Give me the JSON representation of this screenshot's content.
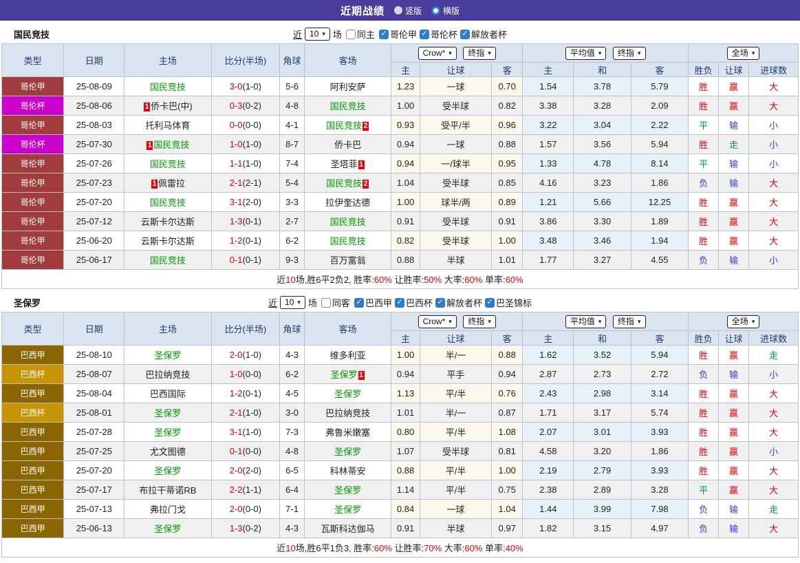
{
  "topbar": {
    "title": "近期战绩",
    "vertical_label": "竖版",
    "horizontal_label": "横版",
    "selected": "horizontal"
  },
  "colors": {
    "topbar_bg": "#4A3C9C",
    "colombia_league": "#A23B3B",
    "colombia_cup": "#CC00CC",
    "brazil_league": "#8A6500",
    "brazil_cup": "#C79405",
    "focus_team_green": "#009900",
    "win_red": "#E60000",
    "draw_green": "#009933",
    "lose_blue": "#3340DF",
    "header_bg": "#DAE5F1",
    "odds_bg": "#FCF8EC",
    "avg_bg": "#E6F1F8"
  },
  "headers": {
    "type": "类型",
    "date": "日期",
    "home": "主场",
    "score": "比分(半场)",
    "corner": "角球",
    "away": "客场",
    "oh": "主",
    "ohc": "让球",
    "oa": "客",
    "ah": "主",
    "ad": "和",
    "aa": "客",
    "res": "胜负",
    "hres": "让球",
    "goals": "进球数",
    "selects": {
      "crow": "Crow*",
      "final": "终指",
      "avg": "平均值",
      "final2": "终指",
      "full": "全场"
    }
  },
  "sections": [
    {
      "team": "国民竞技",
      "filter": {
        "near": "近",
        "count": "10",
        "field": "场",
        "same": {
          "label": "同主",
          "checked": false
        },
        "leagues": [
          {
            "label": "哥伦甲",
            "checked": true
          },
          {
            "label": "哥伦杯",
            "checked": true
          },
          {
            "label": "解放者杯",
            "checked": true
          }
        ]
      },
      "rows": [
        {
          "type": "哥伦甲",
          "type_color": "#A23B3B",
          "date": "25-08-09",
          "home": {
            "name": "国民竞技",
            "focus": true
          },
          "score": "3-0",
          "half": "(1-0)",
          "corners": "5-6",
          "away": {
            "name": "阿利安萨",
            "focus": false
          },
          "odds": [
            "1.23",
            "一球",
            "0.70"
          ],
          "avg": [
            "1.54",
            "3.78",
            "5.79"
          ],
          "results": [
            [
              "胜",
              "r"
            ],
            [
              "赢",
              "r"
            ],
            [
              "大",
              "r"
            ]
          ]
        },
        {
          "type": "哥伦杯",
          "type_color": "#CC00CC",
          "date": "25-08-06",
          "home": {
            "name": "侨卡巴(中)",
            "focus": false,
            "badge_before": "1"
          },
          "score": "0-3",
          "half": "(0-2)",
          "corners": "4-8",
          "away": {
            "name": "国民竞技",
            "focus": true
          },
          "odds": [
            "1.00",
            "受半球",
            "0.82"
          ],
          "avg": [
            "3.38",
            "3.28",
            "2.09"
          ],
          "results": [
            [
              "胜",
              "r"
            ],
            [
              "赢",
              "r"
            ],
            [
              "大",
              "r"
            ]
          ]
        },
        {
          "type": "哥伦甲",
          "type_color": "#A23B3B",
          "date": "25-08-03",
          "home": {
            "name": "托利马体育",
            "focus": false
          },
          "score": "0-0",
          "half": "(0-0)",
          "corners": "4-1",
          "away": {
            "name": "国民竞技",
            "focus": true,
            "badge_after": "2"
          },
          "odds": [
            "0.93",
            "受平/半",
            "0.96"
          ],
          "avg": [
            "3.22",
            "3.04",
            "2.22"
          ],
          "results": [
            [
              "平",
              "g"
            ],
            [
              "输",
              "b"
            ],
            [
              "小",
              "b"
            ]
          ]
        },
        {
          "type": "哥伦杯",
          "type_color": "#CC00CC",
          "date": "25-07-30",
          "home": {
            "name": "国民竞技",
            "focus": true,
            "badge_before": "1"
          },
          "score": "1-0",
          "half": "(1-0)",
          "corners": "8-7",
          "away": {
            "name": "侨卡巴",
            "focus": false
          },
          "odds": [
            "0.94",
            "一球",
            "0.88"
          ],
          "avg": [
            "1.57",
            "3.56",
            "5.94"
          ],
          "results": [
            [
              "胜",
              "r"
            ],
            [
              "走",
              "g"
            ],
            [
              "小",
              "b"
            ]
          ]
        },
        {
          "type": "哥伦甲",
          "type_color": "#A23B3B",
          "date": "25-07-26",
          "home": {
            "name": "国民竞技",
            "focus": true
          },
          "score": "1-1",
          "half": "(1-0)",
          "corners": "7-4",
          "away": {
            "name": "圣塔菲",
            "focus": false,
            "badge_after": "1"
          },
          "odds": [
            "0.94",
            "一/球半",
            "0.95"
          ],
          "avg": [
            "1.33",
            "4.78",
            "8.14"
          ],
          "results": [
            [
              "平",
              "g"
            ],
            [
              "输",
              "b"
            ],
            [
              "小",
              "b"
            ]
          ]
        },
        {
          "type": "哥伦甲",
          "type_color": "#A23B3B",
          "date": "25-07-23",
          "home": {
            "name": "佩雷拉",
            "focus": false,
            "badge_before": "1"
          },
          "score": "2-1",
          "half": "(2-1)",
          "corners": "5-4",
          "away": {
            "name": "国民竞技",
            "focus": true,
            "badge_after": "2"
          },
          "odds": [
            "1.04",
            "受半球",
            "0.85"
          ],
          "avg": [
            "4.16",
            "3.23",
            "1.86"
          ],
          "results": [
            [
              "负",
              "b"
            ],
            [
              "输",
              "b"
            ],
            [
              "大",
              "r"
            ]
          ]
        },
        {
          "type": "哥伦甲",
          "type_color": "#A23B3B",
          "date": "25-07-20",
          "home": {
            "name": "国民竞技",
            "focus": true
          },
          "score": "3-1",
          "half": "(2-0)",
          "corners": "3-3",
          "away": {
            "name": "拉伊奎达德",
            "focus": false
          },
          "odds": [
            "1.00",
            "球半/两",
            "0.89"
          ],
          "avg": [
            "1.21",
            "5.66",
            "12.25"
          ],
          "results": [
            [
              "胜",
              "r"
            ],
            [
              "赢",
              "r"
            ],
            [
              "大",
              "r"
            ]
          ]
        },
        {
          "type": "哥伦甲",
          "type_color": "#A23B3B",
          "date": "25-07-12",
          "home": {
            "name": "云斯卡尔达斯",
            "focus": false
          },
          "score": "1-3",
          "half": "(0-1)",
          "corners": "2-7",
          "away": {
            "name": "国民竞技",
            "focus": true
          },
          "odds": [
            "0.91",
            "受半球",
            "0.91"
          ],
          "avg": [
            "3.86",
            "3.30",
            "1.89"
          ],
          "results": [
            [
              "胜",
              "r"
            ],
            [
              "赢",
              "r"
            ],
            [
              "大",
              "r"
            ]
          ]
        },
        {
          "type": "哥伦甲",
          "type_color": "#A23B3B",
          "date": "25-06-20",
          "home": {
            "name": "云斯卡尔达斯",
            "focus": false
          },
          "score": "1-2",
          "half": "(0-1)",
          "corners": "6-2",
          "away": {
            "name": "国民竞技",
            "focus": true
          },
          "odds": [
            "0.82",
            "受半球",
            "1.00"
          ],
          "avg": [
            "3.48",
            "3.46",
            "1.94"
          ],
          "results": [
            [
              "胜",
              "r"
            ],
            [
              "赢",
              "r"
            ],
            [
              "大",
              "r"
            ]
          ]
        },
        {
          "type": "哥伦甲",
          "type_color": "#A23B3B",
          "date": "25-06-17",
          "home": {
            "name": "国民竞技",
            "focus": true
          },
          "score": "0-1",
          "half": "(0-1)",
          "corners": "9-3",
          "away": {
            "name": "百万富翁",
            "focus": false
          },
          "odds": [
            "0.88",
            "半球",
            "1.01"
          ],
          "avg": [
            "1.77",
            "3.27",
            "4.55"
          ],
          "results": [
            [
              "负",
              "b"
            ],
            [
              "输",
              "b"
            ],
            [
              "小",
              "b"
            ]
          ]
        }
      ],
      "summary": [
        {
          "t": "近",
          "red": false
        },
        {
          "t": "10",
          "red": true
        },
        {
          "t": "场,胜6平2负2, 胜率:",
          "red": false
        },
        {
          "t": "60%",
          "red": true
        },
        {
          "t": " 让胜率:",
          "red": false
        },
        {
          "t": "50%",
          "red": true
        },
        {
          "t": " 大率:",
          "red": false
        },
        {
          "t": "60%",
          "red": true
        },
        {
          "t": " 单率:",
          "red": false
        },
        {
          "t": "60%",
          "red": true
        }
      ]
    },
    {
      "team": "圣保罗",
      "filter": {
        "near": "近",
        "count": "10",
        "field": "场",
        "same": {
          "label": "同客",
          "checked": false
        },
        "leagues": [
          {
            "label": "巴西甲",
            "checked": true
          },
          {
            "label": "巴西杯",
            "checked": true
          },
          {
            "label": "解放者杯",
            "checked": true
          },
          {
            "label": "巴圣锦标",
            "checked": true
          }
        ]
      },
      "rows": [
        {
          "type": "巴西甲",
          "type_color": "#8A6500",
          "date": "25-08-10",
          "home": {
            "name": "圣保罗",
            "focus": true
          },
          "score": "2-0",
          "half": "(1-0)",
          "corners": "4-3",
          "away": {
            "name": "维多利亚",
            "focus": false
          },
          "odds": [
            "1.00",
            "半/一",
            "0.88"
          ],
          "avg": [
            "1.62",
            "3.52",
            "5.94"
          ],
          "results": [
            [
              "胜",
              "r"
            ],
            [
              "赢",
              "r"
            ],
            [
              "走",
              "g"
            ]
          ]
        },
        {
          "type": "巴西杯",
          "type_color": "#C79405",
          "date": "25-08-07",
          "home": {
            "name": "巴拉纳竞技",
            "focus": false
          },
          "score": "1-0",
          "half": "(0-0)",
          "corners": "6-2",
          "away": {
            "name": "圣保罗",
            "focus": true,
            "badge_after": "1"
          },
          "odds": [
            "0.94",
            "平手",
            "0.94"
          ],
          "avg": [
            "2.87",
            "2.73",
            "2.72"
          ],
          "results": [
            [
              "负",
              "b"
            ],
            [
              "输",
              "b"
            ],
            [
              "小",
              "b"
            ]
          ]
        },
        {
          "type": "巴西甲",
          "type_color": "#8A6500",
          "date": "25-08-04",
          "home": {
            "name": "巴西国际",
            "focus": false
          },
          "score": "1-2",
          "half": "(0-1)",
          "corners": "4-5",
          "away": {
            "name": "圣保罗",
            "focus": true
          },
          "odds": [
            "1.13",
            "平/半",
            "0.76"
          ],
          "avg": [
            "2.43",
            "2.98",
            "3.14"
          ],
          "results": [
            [
              "胜",
              "r"
            ],
            [
              "赢",
              "r"
            ],
            [
              "大",
              "r"
            ]
          ]
        },
        {
          "type": "巴西杯",
          "type_color": "#C79405",
          "date": "25-08-01",
          "home": {
            "name": "圣保罗",
            "focus": true
          },
          "score": "2-1",
          "half": "(1-0)",
          "corners": "3-0",
          "away": {
            "name": "巴拉纳竞技",
            "focus": false
          },
          "odds": [
            "1.01",
            "半/一",
            "0.87"
          ],
          "avg": [
            "1.71",
            "3.17",
            "5.74"
          ],
          "results": [
            [
              "胜",
              "r"
            ],
            [
              "赢",
              "r"
            ],
            [
              "大",
              "r"
            ]
          ]
        },
        {
          "type": "巴西甲",
          "type_color": "#8A6500",
          "date": "25-07-28",
          "home": {
            "name": "圣保罗",
            "focus": true
          },
          "score": "3-1",
          "half": "(1-0)",
          "corners": "7-3",
          "away": {
            "name": "弗鲁米嫩塞",
            "focus": false
          },
          "odds": [
            "0.80",
            "平/半",
            "1.08"
          ],
          "avg": [
            "2.07",
            "3.01",
            "3.93"
          ],
          "results": [
            [
              "胜",
              "r"
            ],
            [
              "赢",
              "r"
            ],
            [
              "大",
              "r"
            ]
          ]
        },
        {
          "type": "巴西甲",
          "type_color": "#8A6500",
          "date": "25-07-25",
          "home": {
            "name": "尤文图德",
            "focus": false
          },
          "score": "0-1",
          "half": "(0-0)",
          "corners": "4-8",
          "away": {
            "name": "圣保罗",
            "focus": true
          },
          "odds": [
            "1.07",
            "受半球",
            "0.81"
          ],
          "avg": [
            "4.58",
            "3.20",
            "1.86"
          ],
          "results": [
            [
              "胜",
              "r"
            ],
            [
              "赢",
              "r"
            ],
            [
              "小",
              "b"
            ]
          ]
        },
        {
          "type": "巴西甲",
          "type_color": "#8A6500",
          "date": "25-07-20",
          "home": {
            "name": "圣保罗",
            "focus": true
          },
          "score": "2-0",
          "half": "(2-0)",
          "corners": "6-5",
          "away": {
            "name": "科林蒂安",
            "focus": false
          },
          "odds": [
            "0.88",
            "平/半",
            "1.00"
          ],
          "avg": [
            "2.19",
            "2.79",
            "3.93"
          ],
          "results": [
            [
              "胜",
              "r"
            ],
            [
              "赢",
              "r"
            ],
            [
              "大",
              "r"
            ]
          ]
        },
        {
          "type": "巴西甲",
          "type_color": "#8A6500",
          "date": "25-07-17",
          "home": {
            "name": "布拉干蒂诺RB",
            "focus": false
          },
          "score": "2-2",
          "half": "(1-1)",
          "corners": "6-4",
          "away": {
            "name": "圣保罗",
            "focus": true
          },
          "odds": [
            "1.14",
            "平/半",
            "0.75"
          ],
          "avg": [
            "2.38",
            "2.89",
            "3.28"
          ],
          "results": [
            [
              "平",
              "g"
            ],
            [
              "赢",
              "r"
            ],
            [
              "大",
              "r"
            ]
          ]
        },
        {
          "type": "巴西甲",
          "type_color": "#8A6500",
          "date": "25-07-13",
          "home": {
            "name": "弗拉门戈",
            "focus": false
          },
          "score": "2-0",
          "half": "(0-0)",
          "corners": "7-1",
          "away": {
            "name": "圣保罗",
            "focus": true
          },
          "odds": [
            "0.84",
            "一球",
            "1.04"
          ],
          "avg": [
            "1.44",
            "3.99",
            "7.98"
          ],
          "results": [
            [
              "负",
              "b"
            ],
            [
              "输",
              "b"
            ],
            [
              "走",
              "g"
            ]
          ]
        },
        {
          "type": "巴西甲",
          "type_color": "#8A6500",
          "date": "25-06-13",
          "home": {
            "name": "圣保罗",
            "focus": true
          },
          "score": "1-3",
          "half": "(0-2)",
          "corners": "4-3",
          "away": {
            "name": "瓦斯科达伽马",
            "focus": false
          },
          "odds": [
            "0.91",
            "半球",
            "0.97"
          ],
          "avg": [
            "1.82",
            "3.15",
            "4.97"
          ],
          "results": [
            [
              "负",
              "b"
            ],
            [
              "输",
              "b"
            ],
            [
              "大",
              "r"
            ]
          ]
        }
      ],
      "summary": [
        {
          "t": "近",
          "red": false
        },
        {
          "t": "10",
          "red": true
        },
        {
          "t": "场,胜6平1负3, 胜率:",
          "red": false
        },
        {
          "t": "60%",
          "red": true
        },
        {
          "t": " 让胜率:",
          "red": false
        },
        {
          "t": "70%",
          "red": true
        },
        {
          "t": " 大率:",
          "red": false
        },
        {
          "t": "60%",
          "red": true
        },
        {
          "t": " 单率:",
          "red": false
        },
        {
          "t": "40%",
          "red": true
        }
      ]
    }
  ]
}
